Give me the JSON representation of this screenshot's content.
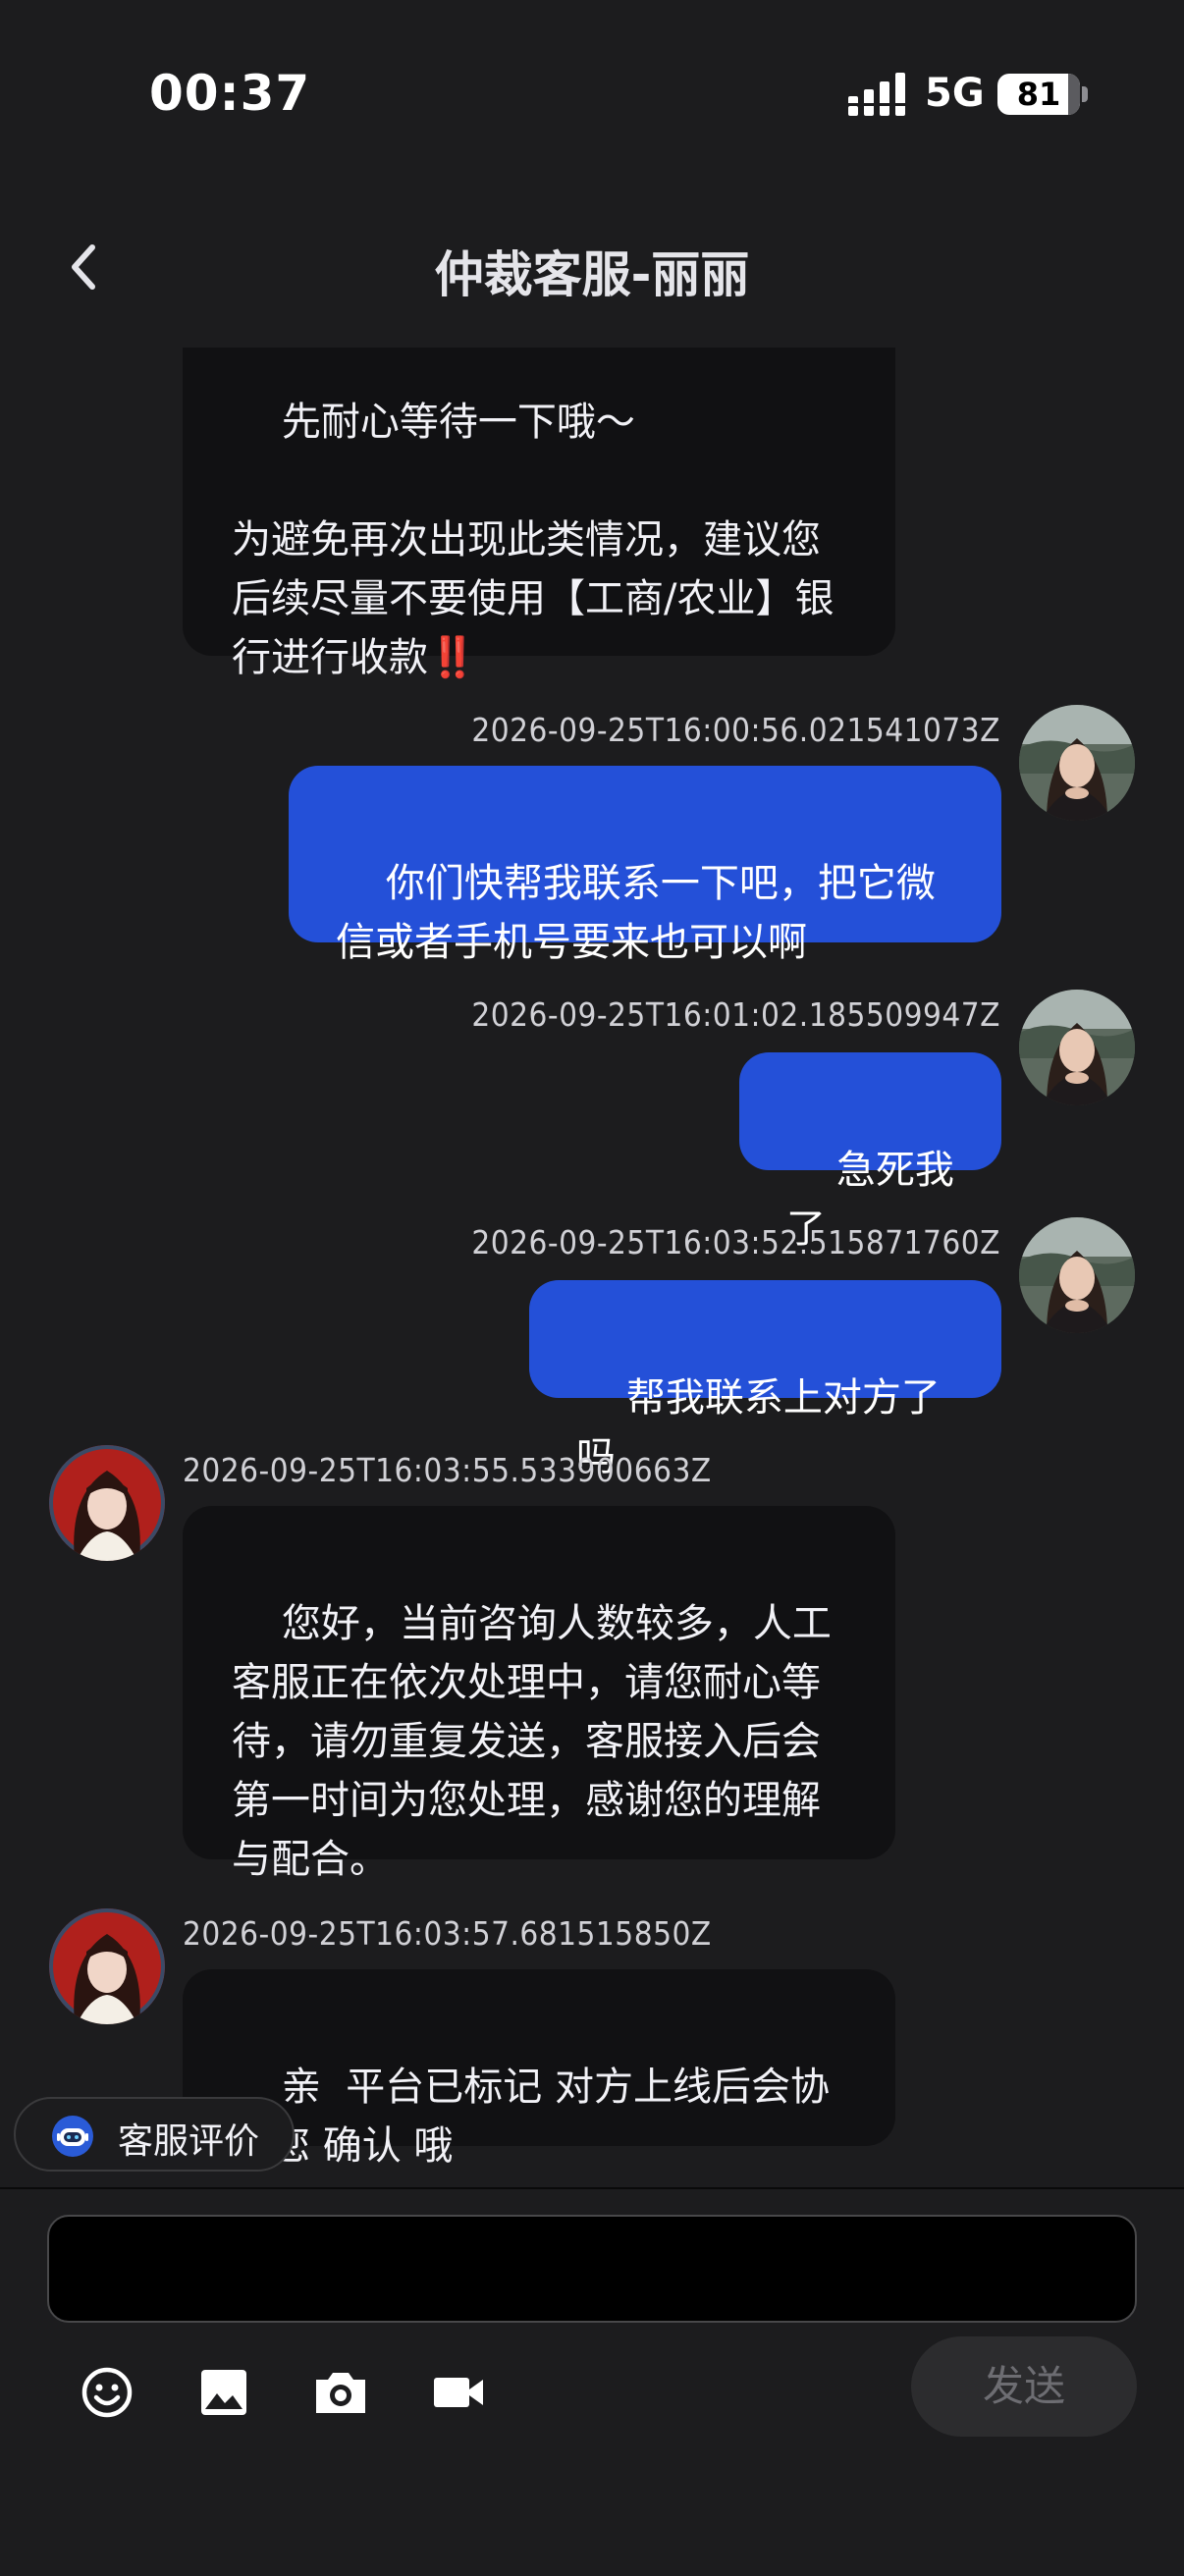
{
  "status_bar": {
    "time": "00:37",
    "network": "5G",
    "battery": "81"
  },
  "nav": {
    "title": "仲裁客服-丽丽"
  },
  "messages": [
    {
      "direction": "in",
      "text": "先耐心等待一下哦～\n\n为避免再次出现此类情况，建议您后续尽量不要使用【工商/农业】银行进行收款",
      "emoji": "‼️"
    },
    {
      "direction": "out",
      "timestamp": "2026-09-25T16:00:56.021541073Z",
      "text": "你们快帮我联系一下吧，把它微信或者手机号要来也可以啊"
    },
    {
      "direction": "out",
      "timestamp": "2026-09-25T16:01:02.185509947Z",
      "text": "急死我了"
    },
    {
      "direction": "out",
      "timestamp": "2026-09-25T16:03:52.515871760Z",
      "text": "帮我联系上对方了吗"
    },
    {
      "direction": "in",
      "timestamp": "2026-09-25T16:03:55.533900663Z",
      "text": "您好，当前咨询人数较多，人工客服正在依次处理中，请您耐心等待，请勿重复发送，客服接入后会第一时间为您处理，感谢您的理解与配合。"
    },
    {
      "direction": "in",
      "timestamp": "2026-09-25T16:03:57.681515850Z",
      "text": "亲  平台已标记 对方上线后会协助您 确认 哦"
    }
  ],
  "rating_chip": {
    "label": "客服评价",
    "icon": "robot-icon"
  },
  "composer": {
    "value": "",
    "placeholder": "",
    "tools": [
      "emoji-icon",
      "image-icon",
      "camera-icon",
      "video-icon"
    ],
    "send_label": "发送"
  },
  "colors": {
    "background": "#1c1c1e",
    "incoming_bubble": "#111113",
    "outgoing_bubble": "#2450d8",
    "send_button": "#2c2c2e"
  }
}
